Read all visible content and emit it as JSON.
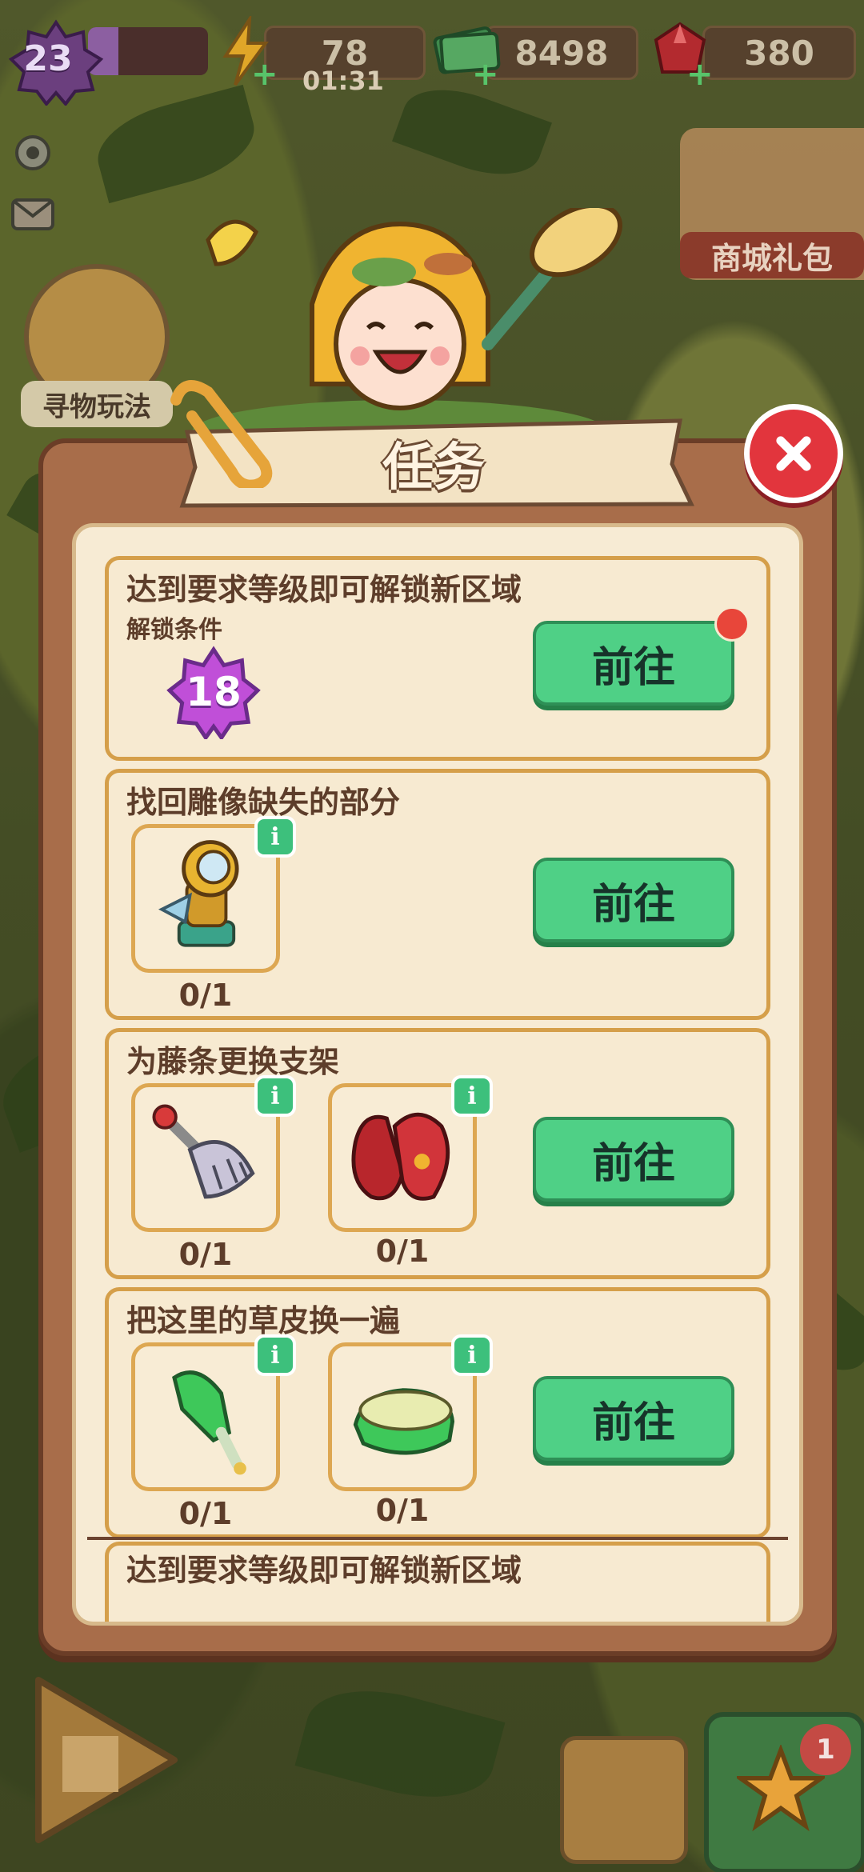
{
  "hud": {
    "level": "23",
    "xp_progress": 0.25,
    "energy": "78",
    "energy_timer": "01:31",
    "cash": "8498",
    "gems": "380"
  },
  "side": {
    "seek_label": "寻物玩法",
    "shop_label": "商城礼包"
  },
  "dialog": {
    "title": "任务",
    "go_label": "前往",
    "tasks": [
      {
        "title": "达到要求等级即可解锁新区域",
        "sub": "解锁条件",
        "level": "18"
      },
      {
        "title": "找回雕像缺失的部分",
        "items": [
          {
            "icon": "golden-telescope-icon",
            "count": "0/1"
          }
        ]
      },
      {
        "title": "为藤条更换支架",
        "items": [
          {
            "icon": "garden-rake-icon",
            "count": "0/1"
          },
          {
            "icon": "red-gloves-icon",
            "count": "0/1"
          }
        ]
      },
      {
        "title": "把这里的草皮换一遍",
        "items": [
          {
            "icon": "green-brush-icon",
            "count": "0/1"
          },
          {
            "icon": "turf-roll-icon",
            "count": "0/1"
          }
        ]
      },
      {
        "title": "达到要求等级即可解锁新区域"
      }
    ]
  },
  "bottom": {
    "notification_count": "1"
  },
  "colors": {
    "go_button": "#4fd086",
    "close_button": "#e2353d",
    "card_border": "#d59f4a",
    "panel": "#a86d4a"
  }
}
